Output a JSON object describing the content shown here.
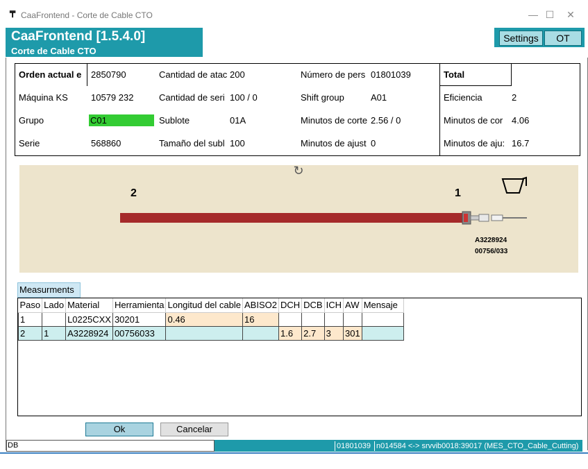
{
  "window": {
    "title": "CaaFrontend - Corte de Cable CTO",
    "icon": "app-icon"
  },
  "header": {
    "app_name": "CaaFrontend [1.5.4.0]",
    "subtitle": "Corte de Cable CTO",
    "settings_label": "Settings",
    "ot_label": "OT",
    "accent_color": "#1e9aaa"
  },
  "info": {
    "orden_label": "Orden actual e",
    "orden_value": "2850790",
    "maquina_label": "Máquina KS",
    "maquina_value": "10579 232",
    "grupo_label": "Grupo",
    "grupo_value": "C01",
    "serie_label": "Serie",
    "serie_value": "568860",
    "cant_atac_label": "Cantidad de atac",
    "cant_atac_value": "200",
    "cant_serie_label": "Cantidad de seri",
    "cant_serie_value": "100 / 0",
    "sublote_label": "Sublote",
    "sublote_value": "01A",
    "tam_sublote_label": "Tamaño del subl",
    "tam_sublote_value": "100",
    "num_pers_label": "Número de pers",
    "num_pers_value": "01801039",
    "shift_label": "Shift group",
    "shift_value": "A01",
    "min_corte_label": "Minutos de corte",
    "min_corte_value": "2.56 / 0",
    "min_ajust_label": "Minutos de ajust",
    "min_ajust_value": "0",
    "total_label": "Total",
    "eficiencia_label": "Eficiencia",
    "eficiencia_value": "2",
    "min_cor_label": "Minutos de cor",
    "min_cor_value": "4.06",
    "min_aju_label": "Minutos de aju:",
    "min_aju_value": "16.7"
  },
  "drawing": {
    "left_end": "2",
    "right_end": "1",
    "part_number": "A3228924",
    "tool_number": "00756/033",
    "background_color": "#ede4cc",
    "cable_color": "#a52a2a"
  },
  "measurements": {
    "tab_label": "Measurments",
    "columns": [
      "Paso",
      "Lado",
      "Material",
      "Herramienta",
      "Longitud del cable",
      "ABISO2",
      "DCH",
      "DCB",
      "ICH",
      "AW",
      "Mensaje"
    ],
    "rows": [
      [
        "1",
        "",
        "L0225CXX",
        "30201",
        "0.46",
        "16",
        "",
        "",
        "",
        "",
        ""
      ],
      [
        "2",
        "1",
        "A3228924",
        "00756033",
        "",
        "",
        "1.6",
        "2.7",
        "3",
        "301",
        ""
      ]
    ]
  },
  "footer": {
    "ok_label": "Ok",
    "cancel_label": "Cancelar"
  },
  "status": {
    "db_label": "DB",
    "user": "01801039",
    "connection": "n014584 <-> srvvib0018:39017 (MES_CTO_Cable_Cutting)"
  }
}
